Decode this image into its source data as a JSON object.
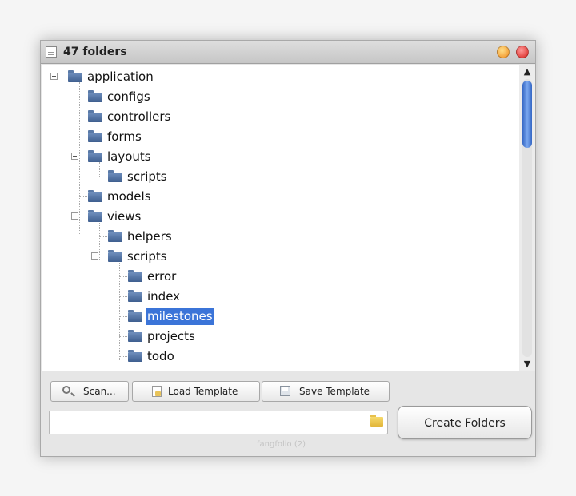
{
  "window": {
    "title": "47 folders"
  },
  "tree": {
    "items": [
      {
        "label": "application",
        "depth": 0,
        "expanded": true,
        "selected": false
      },
      {
        "label": "configs",
        "depth": 1,
        "expanded": false,
        "selected": false
      },
      {
        "label": "controllers",
        "depth": 1,
        "expanded": false,
        "selected": false
      },
      {
        "label": "forms",
        "depth": 1,
        "expanded": false,
        "selected": false
      },
      {
        "label": "layouts",
        "depth": 1,
        "expanded": true,
        "selected": false
      },
      {
        "label": "scripts",
        "depth": 2,
        "expanded": false,
        "selected": false
      },
      {
        "label": "models",
        "depth": 1,
        "expanded": false,
        "selected": false
      },
      {
        "label": "views",
        "depth": 1,
        "expanded": true,
        "selected": false
      },
      {
        "label": "helpers",
        "depth": 2,
        "expanded": false,
        "selected": false
      },
      {
        "label": "scripts",
        "depth": 2,
        "expanded": true,
        "selected": false
      },
      {
        "label": "error",
        "depth": 3,
        "expanded": false,
        "selected": false
      },
      {
        "label": "index",
        "depth": 3,
        "expanded": false,
        "selected": false
      },
      {
        "label": "milestones",
        "depth": 3,
        "expanded": false,
        "selected": true
      },
      {
        "label": "projects",
        "depth": 3,
        "expanded": false,
        "selected": false
      },
      {
        "label": "todo",
        "depth": 3,
        "expanded": false,
        "selected": false
      }
    ]
  },
  "toolbar": {
    "scan_label": "Scan...",
    "load_label": "Load Template",
    "save_label": "Save Template"
  },
  "path": {
    "value": "",
    "placeholder": ""
  },
  "create_label": "Create Folders",
  "status": "fangfolio (2)",
  "colors": {
    "selection": "#3b74d8",
    "scroll_thumb": "#4a7fd8",
    "folder": "#4f6f9f"
  }
}
